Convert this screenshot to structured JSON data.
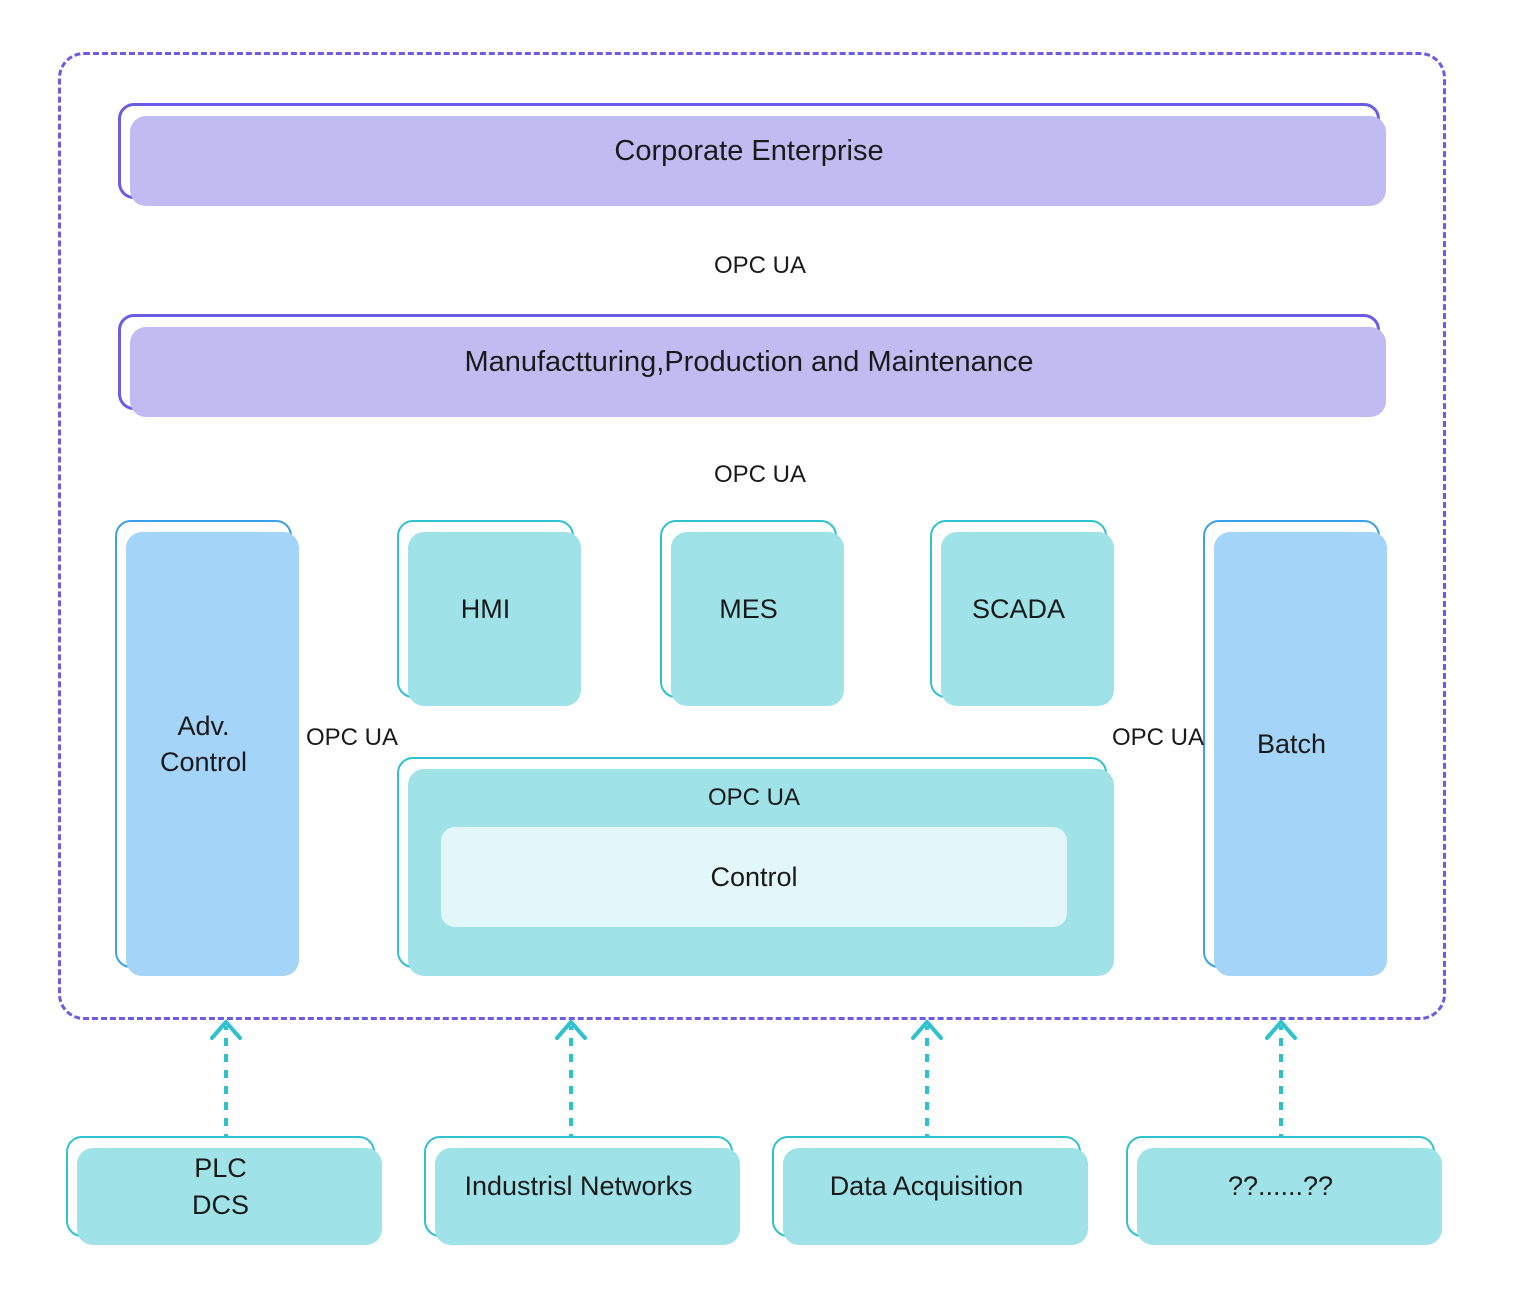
{
  "diagram": {
    "title": "OPC UA Industrial Automation Pyramid",
    "colors": {
      "purple_border": "#6b5ce8",
      "purple_shadow": "#c2bbf2",
      "cyan_border": "#2fc2ce",
      "cyan_shadow": "#9fe3e8",
      "blue_border": "#3ba0ea",
      "blue_shadow": "#a4d4f8",
      "control_band_fill": "#e3f7f8",
      "text": "#1a1a1a",
      "background": "#ffffff"
    },
    "boundary": {
      "style": "dashed",
      "color": "#6b5ce8"
    },
    "levels": {
      "corporate": {
        "label": "Corporate Enterprise"
      },
      "manufacturing": {
        "label": "Manufactturing,Production and Maintenance"
      }
    },
    "connectors": {
      "corp_to_mfg": "OPC UA",
      "mfg_to_ops": "OPC UA",
      "adv_control_side": "OPC UA",
      "batch_side": "OPC UA",
      "control_top": "OPC UA"
    },
    "operations": {
      "adv_control": "Adv.\nControl",
      "hmi": "HMI",
      "mes": "MES",
      "scada": "SCADA",
      "batch": "Batch",
      "control": "Control"
    },
    "field_devices": [
      {
        "label": "PLC\nDCS"
      },
      {
        "label": "Industrisl Networks"
      },
      {
        "label": "Data Acquisition"
      },
      {
        "label": "??......??"
      }
    ]
  }
}
